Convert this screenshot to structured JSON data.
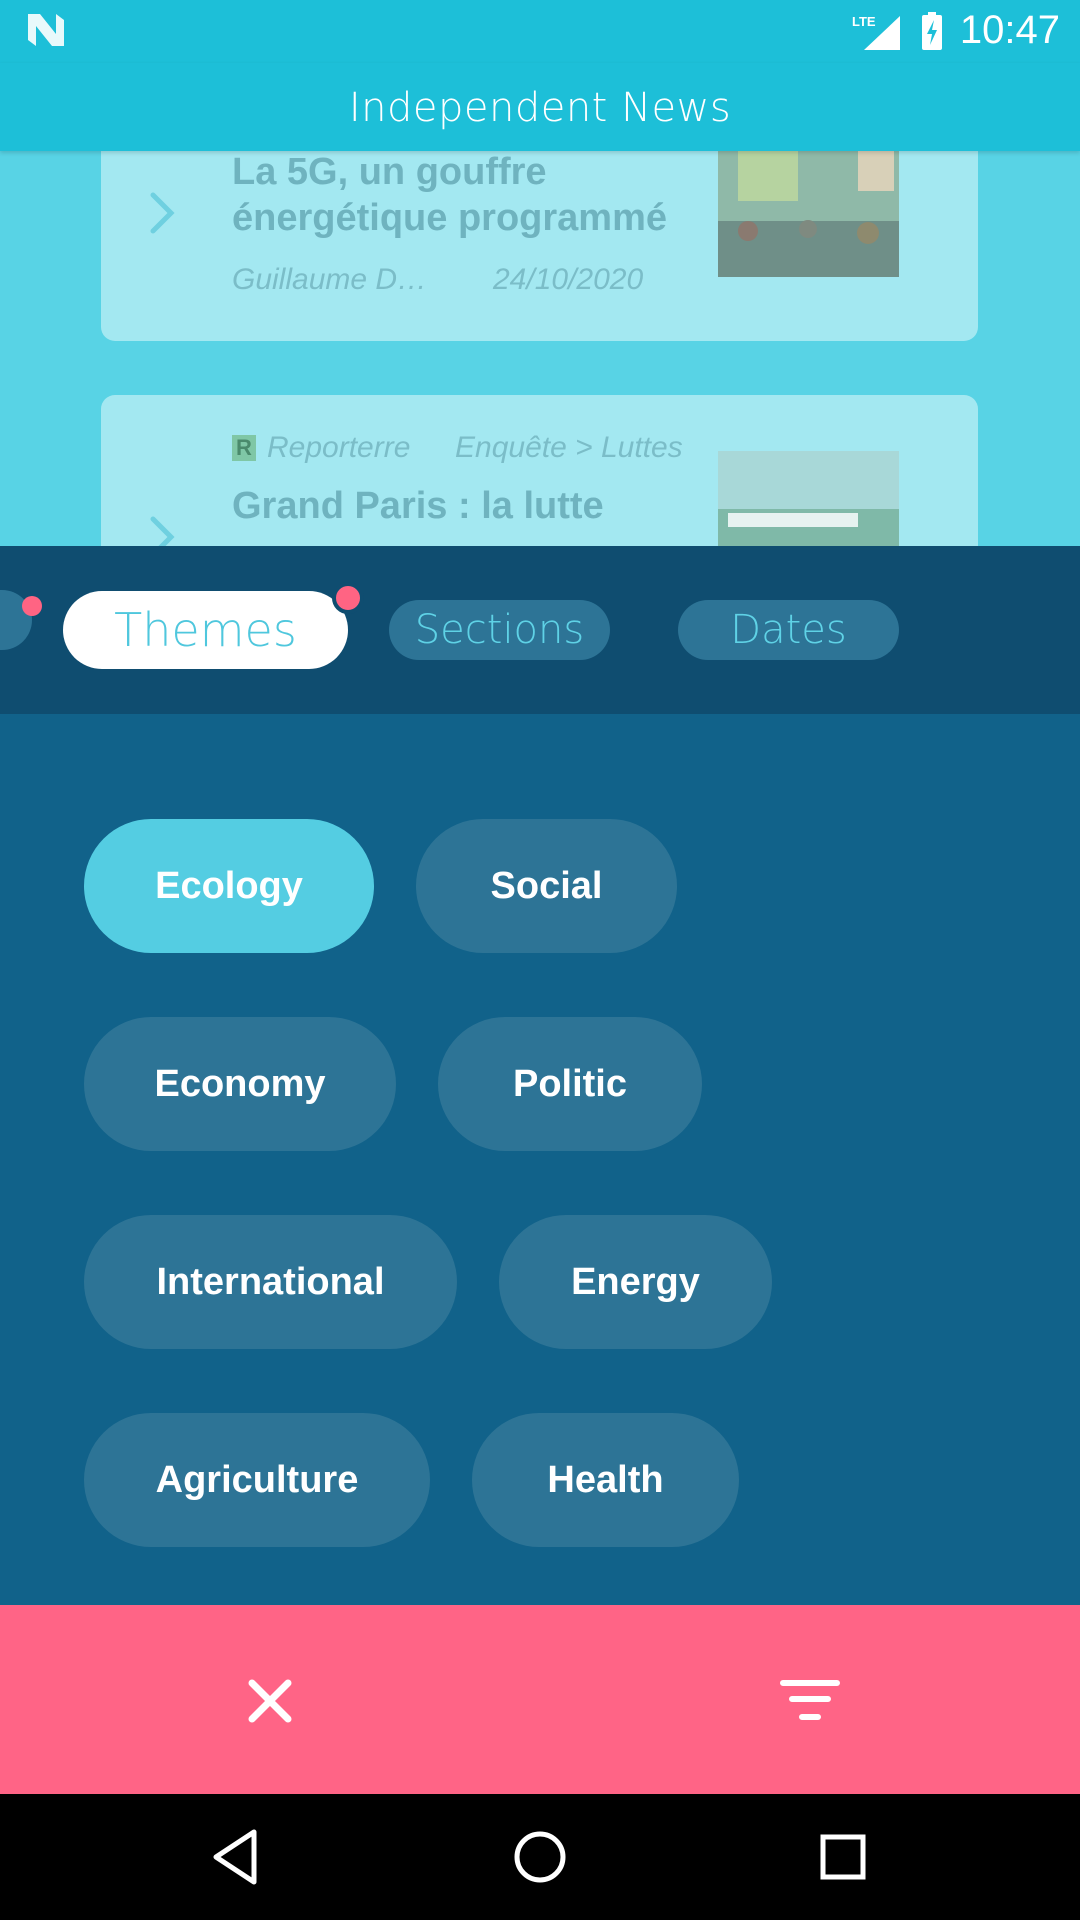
{
  "status_bar": {
    "network_label": "LTE",
    "time": "10:47",
    "icons": [
      "n-logo-icon",
      "signal-icon",
      "battery-charging-icon"
    ]
  },
  "app_bar": {
    "title": "Independent News"
  },
  "feed": {
    "articles": [
      {
        "title_line1": "La 5G, un gouffre",
        "title_line2": "énergétique programmé",
        "author": "Guillaume D…",
        "date": "24/10/2020"
      },
      {
        "source": "Reporterre",
        "source_logo": "R",
        "section": "Enquête > Luttes",
        "title_line1": "Grand Paris : la lutte"
      }
    ]
  },
  "filter_tabs": [
    {
      "label": "Themes",
      "active": true
    },
    {
      "label": "Sections",
      "active": false
    },
    {
      "label": "Dates",
      "active": false
    }
  ],
  "themes": [
    {
      "label": "Ecology",
      "selected": true
    },
    {
      "label": "Social",
      "selected": false
    },
    {
      "label": "Economy",
      "selected": false
    },
    {
      "label": "Politic",
      "selected": false
    },
    {
      "label": "International",
      "selected": false
    },
    {
      "label": "Energy",
      "selected": false
    },
    {
      "label": "Agriculture",
      "selected": false
    },
    {
      "label": "Health",
      "selected": false
    }
  ],
  "actions": {
    "clear_icon": "close-icon",
    "apply_icon": "filter-icon"
  },
  "colors": {
    "primary": "#1dbfd8",
    "panel": "#11628a",
    "chip": "#2d7496",
    "chip_selected": "#54cde2",
    "accent": "#ff6486"
  }
}
